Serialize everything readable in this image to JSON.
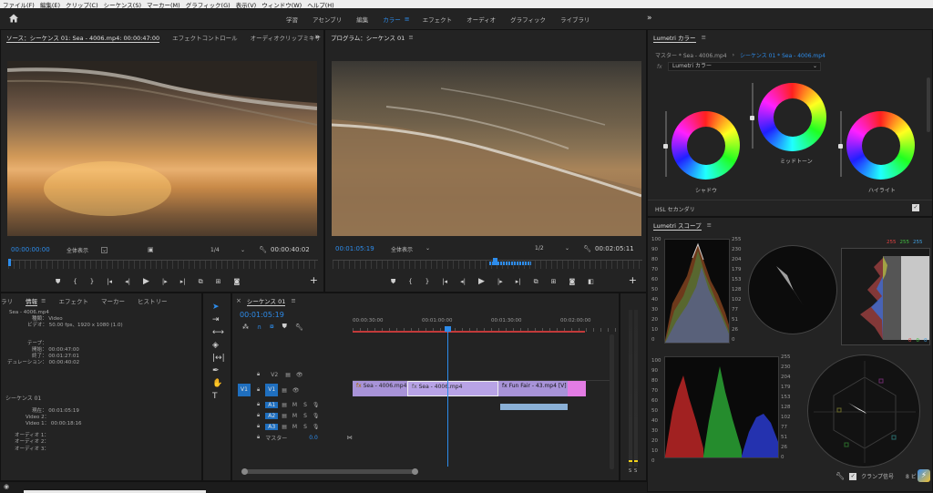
{
  "menu": [
    "ファイル(F)",
    "編集(E)",
    "クリップ(C)",
    "シーケンス(S)",
    "マーカー(M)",
    "グラフィック(G)",
    "表示(V)",
    "ウィンドウ(W)",
    "ヘルプ(H)"
  ],
  "workspaces": [
    "学習",
    "アセンブリ",
    "編集",
    "カラー",
    "エフェクト",
    "オーディオ",
    "グラフィック",
    "ライブラリ"
  ],
  "active_workspace": "カラー",
  "source": {
    "tabs": [
      "ソース：シーケンス 01: Sea - 4006.mp4: 00:00:47:00",
      "エフェクトコントロール",
      "オーディオクリップミキサ"
    ],
    "timecode": "00:00:00:00",
    "fit": "全体表示",
    "ratio": "1/4",
    "duration": "00:00:40:02"
  },
  "program": {
    "tab": "プログラム：シーケンス 01",
    "timecode": "00:01:05:19",
    "fit": "全体表示",
    "ratio": "1/2",
    "duration": "00:02:05:11"
  },
  "info": {
    "tabs": [
      "ラリ",
      "情報",
      "エフェクト",
      "マーカー",
      "ヒストリー"
    ],
    "clip_name": "Sea - 4006.mp4",
    "type_label": "種類：",
    "type_value": "Video",
    "video_label": "ビデオ：",
    "video_value": "50.00 fps、1920 x 1080 (1.0)",
    "tape_label": "テープ：",
    "start_label": "開始：",
    "start_value": "00:00:47:00",
    "end_label": "終了：",
    "end_value": "00:01:27:01",
    "dur_label": "デュレーション：",
    "dur_value": "00:00:40:02",
    "seq_name": "シーケンス 01",
    "current_label": "現在：",
    "current_value": "00:01:05:19",
    "video2": "Video 2：",
    "video1_label": "Video 1：",
    "video1_value": "00:00:18:16",
    "audio1": "オーディオ 1：",
    "audio2": "オーディオ 2：",
    "audio3": "オーディオ 3："
  },
  "timeline": {
    "tab": "シーケンス 01",
    "timecode": "00:01:05:19",
    "ruler": [
      "00:00:30:00",
      "00:01:00:00",
      "00:01:30:00",
      "00:02:00:00"
    ],
    "tracks_video": [
      "V2",
      "V1"
    ],
    "tracks_audio": [
      "A1",
      "A2",
      "A3"
    ],
    "source_patch": "V1",
    "master": "マスター",
    "master_value": "0.0",
    "clips": [
      "Sea - 4006.mp4",
      "Sea - 4006.mp4",
      "Fun Fair - 43.mp4 [V]"
    ],
    "meter_labels": [
      "S",
      "S"
    ]
  },
  "lumetri_color": {
    "tab": "Lumetri カラー",
    "breadcrumb_master": "マスター * Sea - 4006.mp4",
    "breadcrumb_seq": "シーケンス 01 * Sea - 4006.mp4",
    "fx": "fx",
    "fx_name": "Lumetri カラー",
    "wheel_labels": [
      "シャドウ",
      "ミッドトーン",
      "ハイライト"
    ],
    "hsl": "HSL セカンダリ"
  },
  "lumetri_scopes": {
    "tab": "Lumetri スコープ",
    "left_scale": [
      "100",
      "90",
      "80",
      "70",
      "60",
      "50",
      "40",
      "30",
      "20",
      "10",
      "0"
    ],
    "right_scale": [
      "255",
      "230",
      "204",
      "179",
      "153",
      "128",
      "102",
      "77",
      "51",
      "26",
      "0"
    ],
    "rgb_values": [
      "255",
      "255",
      "255"
    ],
    "zero_values": [
      "0",
      "0",
      "0"
    ],
    "clamp_label": "クランプ信号",
    "bit_label": "8 ビ"
  },
  "colors": {
    "accent": "#2d8ceb",
    "playhead": "#2d8ceb",
    "clip_video": "#a893d8",
    "clip_pink": "#e37ce4",
    "clip_audio": "#8ab0d6"
  }
}
